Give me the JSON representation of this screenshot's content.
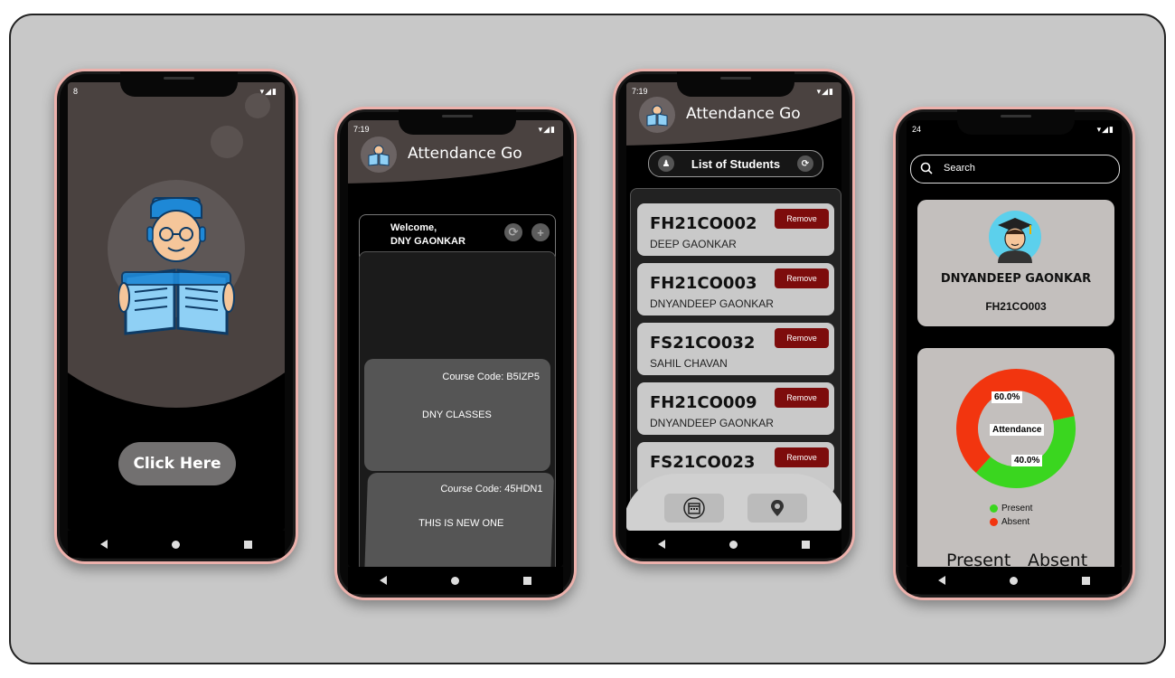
{
  "status_time": {
    "p1": "8",
    "p2": "7:19",
    "p3": "7:19",
    "p4": "24"
  },
  "app": {
    "title": "Attendance Go"
  },
  "phone1": {
    "click_label": "Click Here"
  },
  "phone2": {
    "welcome_line1": "Welcome,",
    "welcome_line2": "DNY GAONKAR",
    "courses": [
      {
        "code": "Course Code: B5IZP5",
        "name": "DNY CLASSES"
      },
      {
        "code": "Course Code: 45HDN1",
        "name": "THIS IS NEW ONE"
      }
    ]
  },
  "phone3": {
    "list_title": "List of Students",
    "remove_label": "Remove",
    "students": [
      {
        "id": "FH21CO002",
        "name": "DEEP GAONKAR"
      },
      {
        "id": "FH21CO003",
        "name": "DNYANDEEP GAONKAR"
      },
      {
        "id": "FS21CO032",
        "name": "SAHIL CHAVAN"
      },
      {
        "id": "FH21CO009",
        "name": "DNYANDEEP GAONKAR"
      },
      {
        "id": "FS21CO023",
        "name": ""
      }
    ]
  },
  "phone4": {
    "search_placeholder": "Search",
    "profile_name": "DNYANDEEP GAONKAR",
    "profile_id": "FH21CO003",
    "present_label": "Present",
    "absent_label": "Absent"
  },
  "chart_data": {
    "type": "pie",
    "title": "Attendance",
    "categories": [
      "Present",
      "Absent"
    ],
    "values": [
      40.0,
      60.0
    ],
    "labels": [
      "40.0%",
      "60.0%"
    ],
    "colors": [
      "#3ad61f",
      "#f2350f"
    ],
    "legend": "bottom"
  }
}
